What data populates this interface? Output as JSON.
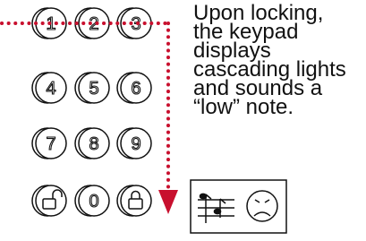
{
  "keypad": {
    "rows": [
      [
        {
          "label": "1",
          "icon": null
        },
        {
          "label": "2",
          "icon": null
        },
        {
          "label": "3",
          "icon": null
        }
      ],
      [
        {
          "label": "4",
          "icon": null
        },
        {
          "label": "5",
          "icon": null
        },
        {
          "label": "6",
          "icon": null
        }
      ],
      [
        {
          "label": "7",
          "icon": null
        },
        {
          "label": "8",
          "icon": null
        },
        {
          "label": "9",
          "icon": null
        }
      ],
      [
        {
          "label": "",
          "icon": "unlock-icon"
        },
        {
          "label": "0",
          "icon": null
        },
        {
          "label": "",
          "icon": "lock-icon"
        }
      ]
    ]
  },
  "caption": {
    "lines": [
      "Upon locking,",
      "the keypad",
      "displays",
      "cascading lights",
      "and sounds a",
      "“low” note."
    ]
  },
  "colors": {
    "path": "#c8102e",
    "ink": "#111111"
  },
  "icons": {
    "sound": "music-notes-icon",
    "face": "sad-face-icon"
  }
}
